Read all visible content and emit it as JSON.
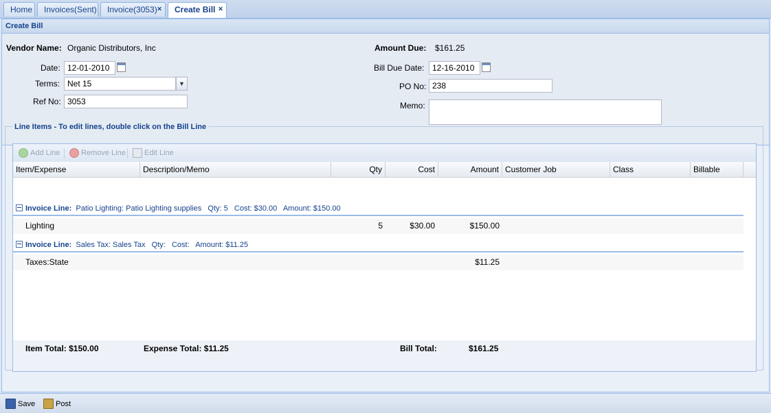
{
  "tabs": [
    {
      "label": "Home",
      "closable": false
    },
    {
      "label": "Invoices(Sent)",
      "closable": false
    },
    {
      "label": "Invoice(3053)",
      "closable": true
    },
    {
      "label": "Create Bill",
      "closable": true,
      "active": true
    }
  ],
  "panel_title": "Create Bill",
  "form": {
    "vendor_label": "Vendor Name:",
    "vendor_value": "Organic Distributors, Inc",
    "date_label": "Date:",
    "date_value": "12-01-2010",
    "terms_label": "Terms:",
    "terms_value": "Net 15",
    "refno_label": "Ref No:",
    "refno_value": "3053",
    "amount_due_label": "Amount Due:",
    "amount_due_value": "$161.25",
    "bill_due_label": "Bill Due Date:",
    "bill_due_value": "12-16-2010",
    "po_label": "PO No:",
    "po_value": "238",
    "memo_label": "Memo:",
    "memo_value": ""
  },
  "line_items": {
    "legend": "Line Items - To edit lines, double click on the Bill Line",
    "toolbar": {
      "add": "Add Line",
      "remove": "Remove Line",
      "edit": "Edit Line"
    },
    "columns": [
      "Item/Expense",
      "Description/Memo",
      "Qty",
      "Cost",
      "Amount",
      "Customer Job",
      "Class",
      "Billable"
    ],
    "groups": [
      {
        "header_bold": "Invoice Line:",
        "header_text": "Patio Lighting: Patio Lighting supplies   Qty: 5   Cost: $30.00   Amount: $150.00",
        "row": {
          "item": "Lighting",
          "desc": "",
          "qty": "5",
          "cost": "$30.00",
          "amount": "$150.00",
          "job": "",
          "class": "",
          "billable": ""
        }
      },
      {
        "header_bold": "Invoice Line:",
        "header_text": "Sales Tax: Sales Tax   Qty:   Cost:   Amount: $11.25",
        "row": {
          "item": "Taxes:State",
          "desc": "",
          "qty": "",
          "cost": "",
          "amount": "$11.25",
          "job": "",
          "class": "",
          "billable": ""
        }
      }
    ],
    "totals": {
      "item_total": "Item Total: $150.00",
      "expense_total": "Expense Total: $11.25",
      "bill_total_label": "Bill Total:",
      "bill_total_value": "$161.25"
    }
  },
  "bottom_toolbar": {
    "save": "Save",
    "post": "Post"
  },
  "colors": {
    "accent": "#15428b",
    "border": "#99bbe8"
  }
}
